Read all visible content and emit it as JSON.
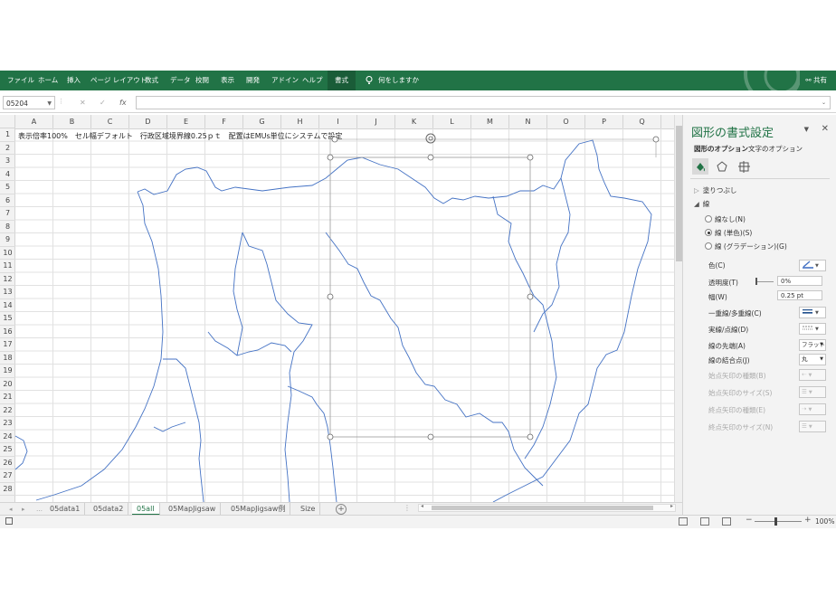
{
  "ribbon": {
    "tabs": [
      "ファイル",
      "ホーム",
      "挿入",
      "ページ レイアウト",
      "数式",
      "データ",
      "校閲",
      "表示",
      "開発",
      "アドイン",
      "ヘルプ",
      "書式"
    ],
    "active_tab": "書式",
    "tell_me": "何をしますか",
    "share": "共有"
  },
  "formula_bar": {
    "name_box": "05204",
    "cancel_icon": "✕",
    "enter_icon": "✓",
    "fx_icon": "fx",
    "value": ""
  },
  "columns": [
    "A",
    "B",
    "C",
    "D",
    "E",
    "F",
    "G",
    "H",
    "I",
    "J",
    "K",
    "L",
    "M",
    "N",
    "O",
    "P",
    "Q"
  ],
  "rows": [
    "1",
    "2",
    "3",
    "4",
    "5",
    "6",
    "7",
    "8",
    "9",
    "10",
    "11",
    "12",
    "13",
    "14",
    "15",
    "16",
    "17",
    "18",
    "19",
    "20",
    "21",
    "22",
    "23",
    "24",
    "25",
    "26",
    "27",
    "28"
  ],
  "cells": {
    "A1": "表示倍率100%　セル幅デフォルト　行政区域境界線0.25ｐｔ　配置はEMUs単位にシステムで設定"
  },
  "sheet_tabs": [
    "05data1",
    "05data2",
    "05all",
    "05MapJigsaw",
    "05MapJigsaw例",
    "Size"
  ],
  "active_sheet": "05all",
  "status_bar": {
    "zoom": "100%"
  },
  "format_pane": {
    "title": "図形の書式設定",
    "tabs": [
      "図形のオプション",
      "文字のオプション"
    ],
    "active_tab": "図形のオプション",
    "icons": [
      "fill-line-icon",
      "effects-icon",
      "size-properties-icon"
    ],
    "sections": {
      "fill": "塗りつぶし",
      "line": "線"
    },
    "line_options": [
      "線なし(N)",
      "線 (単色)(S)",
      "線 (グラデーション)(G)"
    ],
    "line_selected": "線 (単色)(S)",
    "properties": [
      {
        "label": "色(C)",
        "value": ""
      },
      {
        "label": "透明度(T)",
        "value": "0%"
      },
      {
        "label": "幅(W)",
        "value": "0.25 pt"
      },
      {
        "label": "一重線/多重線(C)",
        "value": ""
      },
      {
        "label": "実線/点線(D)",
        "value": ""
      },
      {
        "label": "線の先端(A)",
        "value": "フラット"
      },
      {
        "label": "線の結合点(J)",
        "value": "丸"
      },
      {
        "label": "始点矢印の種類(B)",
        "value": ""
      },
      {
        "label": "始点矢印のサイズ(S)",
        "value": ""
      },
      {
        "label": "終点矢印の種類(E)",
        "value": ""
      },
      {
        "label": "終点矢印のサイズ(N)",
        "value": ""
      }
    ],
    "colors": {
      "accent": "#217346",
      "map_line": "#4472c4"
    }
  }
}
